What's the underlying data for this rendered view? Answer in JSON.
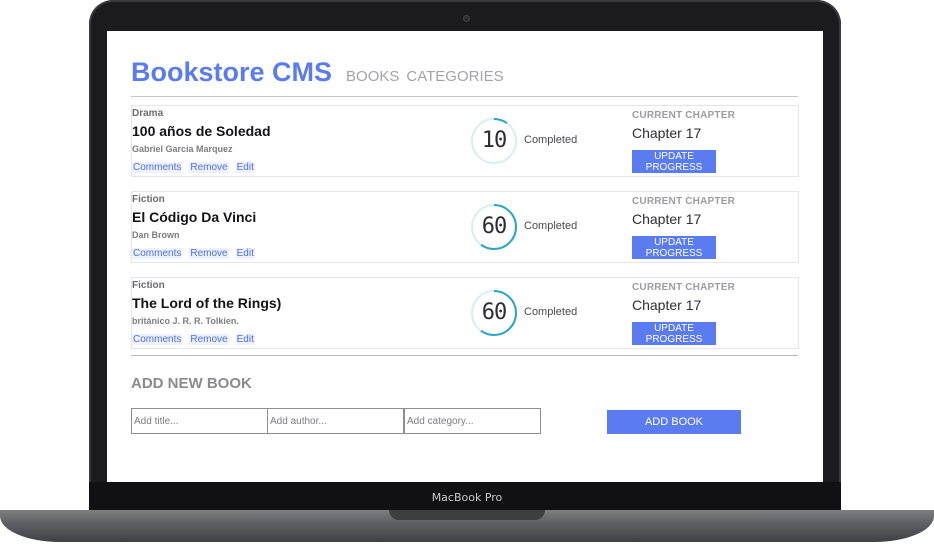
{
  "device": {
    "brand_label": "MacBook Pro"
  },
  "header": {
    "logo": "Bookstore CMS",
    "nav": [
      {
        "label": "BOOKS"
      },
      {
        "label": "CATEGORIES"
      }
    ]
  },
  "books": [
    {
      "category": "Drama",
      "title": "100 años de Soledad",
      "author": "Gabriel Garcia Marquez",
      "actions": [
        "Comments",
        "Remove",
        "Edit"
      ],
      "progress_percent": 10,
      "progress_display": "10",
      "progress_label": "Completed",
      "current_chapter_label": "CURRENT CHAPTER",
      "current_chapter": "Chapter 17",
      "update_button": "UPDATE PROGRESS"
    },
    {
      "category": "Fiction",
      "title": "El Código Da Vinci",
      "author": "Dan Brown",
      "actions": [
        "Comments",
        "Remove",
        "Edit"
      ],
      "progress_percent": 60,
      "progress_display": "60",
      "progress_label": "Completed",
      "current_chapter_label": "CURRENT CHAPTER",
      "current_chapter": "Chapter 17",
      "update_button": "UPDATE PROGRESS"
    },
    {
      "category": "Fiction",
      "title": "The Lord of the Rings)",
      "author": "británico J. R. R. Tolkien.",
      "actions": [
        "Comments",
        "Remove",
        "Edit"
      ],
      "progress_percent": 60,
      "progress_display": "60",
      "progress_label": "Completed",
      "current_chapter_label": "CURRENT CHAPTER",
      "current_chapter": "Chapter 17",
      "update_button": "UPDATE PROGRESS"
    }
  ],
  "add_form": {
    "title": "ADD NEW BOOK",
    "title_placeholder": "Add title...",
    "author_placeholder": "Add author...",
    "category_placeholder": "Add category...",
    "submit_label": "ADD BOOK"
  },
  "colors": {
    "accent": "#5a7cf0",
    "progress_ring": "#2aa6c7",
    "progress_track": "#d7eef4"
  }
}
